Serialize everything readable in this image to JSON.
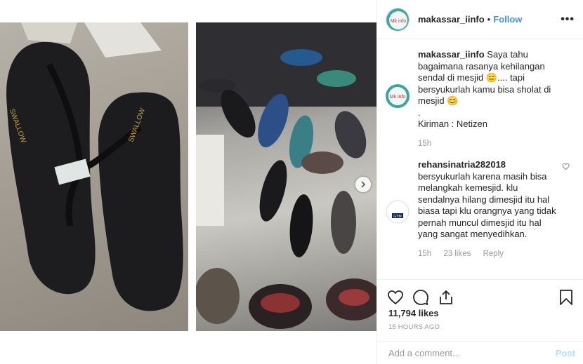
{
  "post": {
    "username": "makassar_iinfo",
    "follow_label": "Follow",
    "more_label": "•••",
    "avatar_text": "Mk info"
  },
  "caption": {
    "username": "makassar_iinfo",
    "text": " Saya tahu bagaimana rasanya kehilangan sendal di mesjid 😑.... tapi bersyukurlah kamu bisa sholat di mesjid 😊",
    "dot_line": ".",
    "credit": "Kiriman : Netizen",
    "time": "15h"
  },
  "comment": {
    "username": "rehansinatria282018",
    "text": " bersyukurlah karena masih bisa melangkah kemesjid. klu sendalnya hilang dimesjid itu hal biasa tapi klu orangnya yang tidak pernah muncul dimesjid itu hal yang sangat menyedihkan.",
    "time": "15h",
    "likes": "23 likes",
    "reply": "Reply",
    "avatar_text": "GYM"
  },
  "likes_count": "11,794 likes",
  "timestamp": "15 HOURS AGO",
  "add_comment": {
    "placeholder": "Add a comment...",
    "post_label": "Post"
  },
  "icons": {
    "like": "heart-icon",
    "comment": "comment-icon",
    "share": "share-icon",
    "save": "bookmark-icon",
    "next": "chevron-right-icon"
  },
  "colors": {
    "follow": "#3897f0",
    "post_disabled": "#b2dffc",
    "muted": "#999999",
    "text": "#262626",
    "avatar_ring": "#3aa7a3"
  }
}
